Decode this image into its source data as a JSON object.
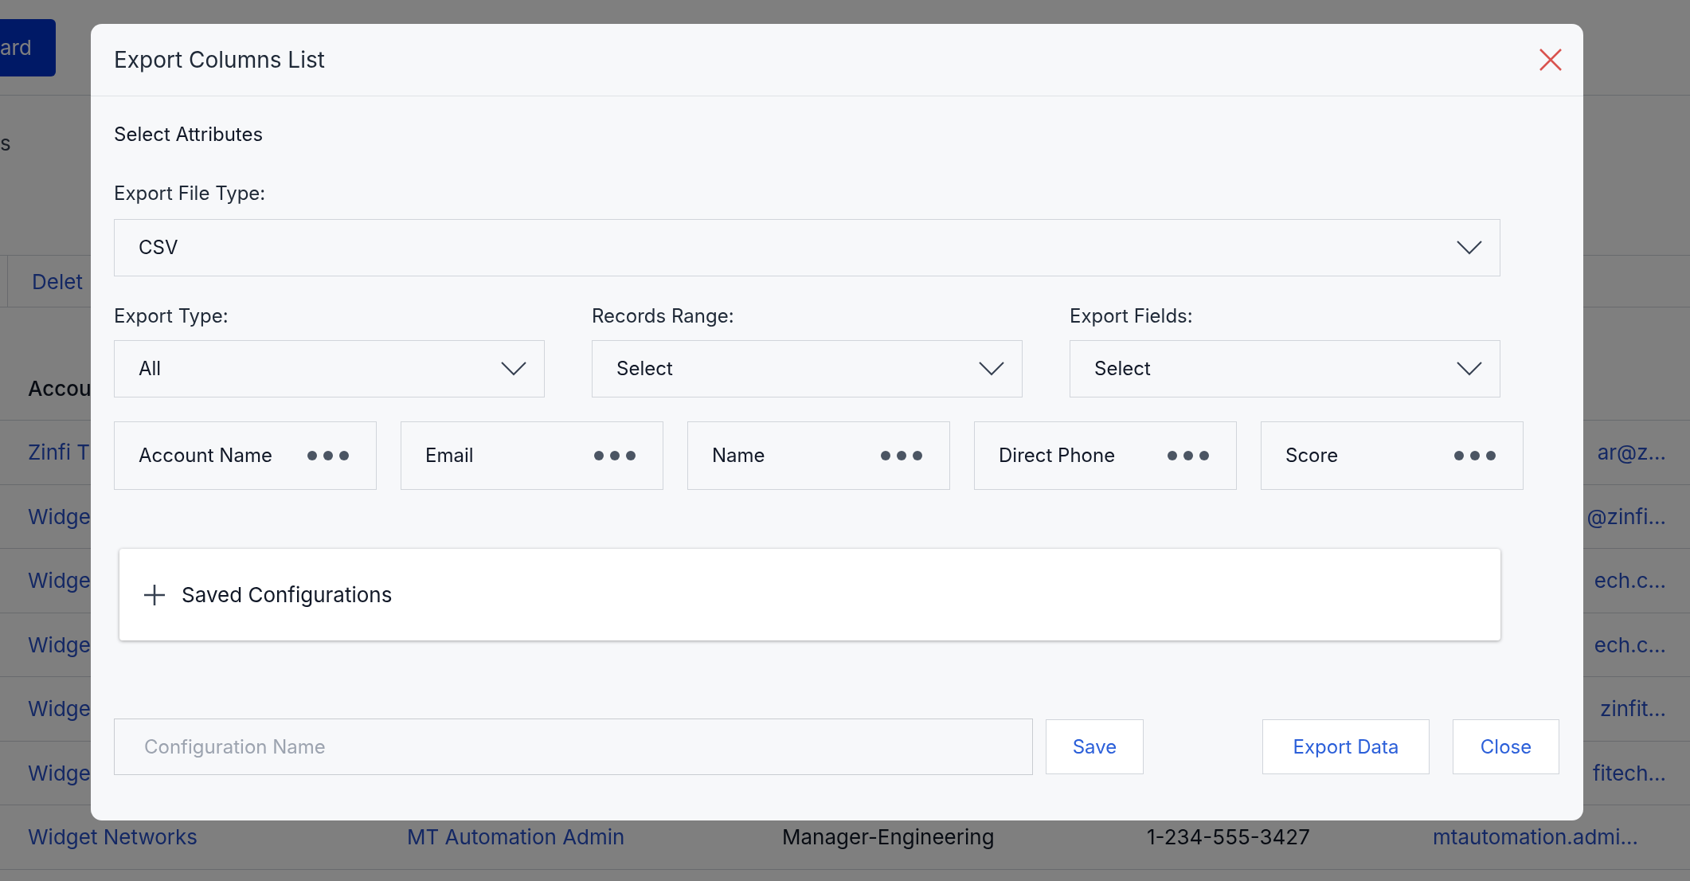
{
  "background": {
    "top_button": "ard",
    "side_text": "s",
    "toolbar_button": "Delet",
    "column_header": "Accou",
    "rows": [
      {
        "left": "Zinfi T",
        "right": "ar@z..."
      },
      {
        "left": "Widge",
        "right": "@zinfi..."
      },
      {
        "left": "Widge",
        "right": "ech.c..."
      },
      {
        "left": "Widge",
        "right": "ech.c..."
      },
      {
        "left": "Widge",
        "right": "zinfit..."
      },
      {
        "left": "Widge",
        "right": "fitech..."
      }
    ],
    "last_row": [
      "Widget Networks",
      "MT Automation Admin",
      "Manager-Engineering",
      "1-234-555-3427",
      "mtautomation.admi..."
    ]
  },
  "dialog": {
    "title": "Export Columns List",
    "section": "Select Attributes",
    "file_type": {
      "label": "Export File Type:",
      "value": "CSV"
    },
    "selects": [
      {
        "label": "Export Type:",
        "value": "All"
      },
      {
        "label": "Records Range:",
        "value": "Select"
      },
      {
        "label": "Export Fields:",
        "value": "Select"
      }
    ],
    "columns": [
      "Account Name",
      "Email",
      "Name",
      "Direct Phone",
      "Score"
    ],
    "saved_configurations": {
      "label": "Saved Configurations",
      "expanded": false
    },
    "config_name": {
      "placeholder": "Configuration Name"
    },
    "save_button": "Save",
    "buttons": [
      "Export Data",
      "Close"
    ]
  }
}
